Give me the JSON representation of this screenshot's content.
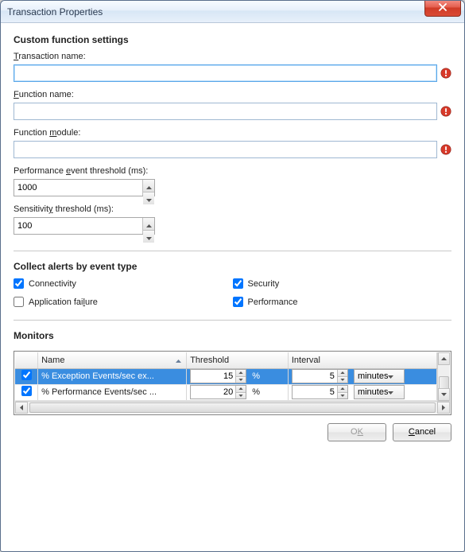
{
  "window": {
    "title": "Transaction Properties"
  },
  "section1": {
    "heading": "Custom function settings",
    "transaction_label_pre": "",
    "transaction_label_u": "T",
    "transaction_label_post": "ransaction name:",
    "transaction_value": "",
    "function_label_pre": "",
    "function_label_u": "F",
    "function_label_post": "unction name:",
    "function_value": "",
    "module_label_pre": "Function ",
    "module_label_u": "m",
    "module_label_post": "odule:",
    "module_value": "",
    "perf_label_pre": "Performance ",
    "perf_label_u": "e",
    "perf_label_post": "vent threshold (ms):",
    "perf_value": "1000",
    "sens_label_pre": "Sensitivit",
    "sens_label_u": "y",
    "sens_label_post": " threshold (ms):",
    "sens_value": "100"
  },
  "section2": {
    "heading": "Collect alerts by event type",
    "connectivity": {
      "label": "Connectivity",
      "checked": true
    },
    "security": {
      "label": "Security",
      "checked": true
    },
    "appfail": {
      "label_pre": "Application fai",
      "label_u": "l",
      "label_post": "ure",
      "checked": false
    },
    "performance": {
      "label": "Performance",
      "checked": true
    }
  },
  "section3": {
    "heading": "Monitors",
    "columns": {
      "name": "Name",
      "threshold": "Threshold",
      "interval": "Interval"
    },
    "unit_pct": "%",
    "rows": [
      {
        "checked": true,
        "name": "% Exception Events/sec ex...",
        "threshold": "15",
        "interval": "5",
        "interval_unit": "minutes"
      },
      {
        "checked": true,
        "name": "% Performance Events/sec ...",
        "threshold": "20",
        "interval": "5",
        "interval_unit": "minutes"
      }
    ]
  },
  "footer": {
    "ok_pre": "O",
    "ok_u": "K",
    "cancel_u": "C",
    "cancel_post": "ancel"
  }
}
